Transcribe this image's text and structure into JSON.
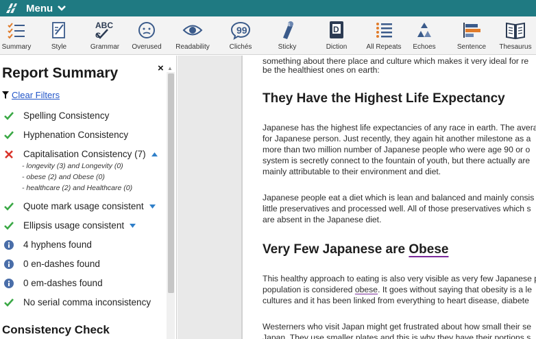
{
  "menubar": {
    "menu_label": "Menu",
    "icon": "feather-logo-icon",
    "bg": "#1f7a82"
  },
  "toolbar": {
    "items": [
      {
        "label": "Summary",
        "icon": "summary-list-icon"
      },
      {
        "label": "Style",
        "icon": "style-pen-icon"
      },
      {
        "label": "Grammar",
        "icon": "grammar-abc-icon"
      },
      {
        "label": "Overused",
        "icon": "overused-face-icon"
      },
      {
        "label": "Readability",
        "icon": "eye-icon"
      },
      {
        "label": "Clichés",
        "icon": "quote-bubble-icon"
      },
      {
        "label": "Sticky",
        "icon": "sticky-glue-icon"
      },
      {
        "label": "Diction",
        "icon": "diction-book-icon"
      },
      {
        "label": "All Repeats",
        "icon": "repeats-list-icon"
      },
      {
        "label": "Echoes",
        "icon": "echoes-recycle-icon"
      },
      {
        "label": "Sentence",
        "icon": "sentence-bars-icon"
      },
      {
        "label": "Thesaurus",
        "icon": "thesaurus-book-icon"
      }
    ]
  },
  "panel": {
    "title": "Report Summary",
    "close": "×",
    "clear_filters": "Clear Filters",
    "rows": [
      {
        "status": "check",
        "label": "Spelling Consistency"
      },
      {
        "status": "check",
        "label": "Hyphenation Consistency"
      },
      {
        "status": "cross",
        "label": "Capitalisation Consistency (7)",
        "expanded": true
      },
      {
        "status": "check",
        "label": "Quote mark usage consistent",
        "collapsed": true
      },
      {
        "status": "check",
        "label": "Ellipsis usage consistent",
        "collapsed": true
      },
      {
        "status": "info",
        "label": "4 hyphens found"
      },
      {
        "status": "info",
        "label": "0 en-dashes found"
      },
      {
        "status": "info",
        "label": "0 em-dashes found"
      },
      {
        "status": "check",
        "label": "No serial comma inconsistency"
      }
    ],
    "sub_items": [
      "- longevity (3) and Longevity (0)",
      "- obese (2) and Obese (0)",
      "- healthcare (2) and Healthcare (0)"
    ],
    "section_title": "Consistency Check",
    "colors": {
      "check": "#3aa845",
      "cross": "#d9342b",
      "info": "#4a6ea9",
      "triangle": "#2f7fc9"
    }
  },
  "doc": {
    "intro": [
      "something about there place and culture which makes it very ideal for re",
      "be the healthiest ones on earth:"
    ],
    "heading1": "They Have the Highest Life Expectancy",
    "para1": [
      "Japanese has the highest life expectancies of any race in earth. The avera",
      "for Japanese person. Just recently, they again hit another milestone as a",
      "more than two million number of Japanese people who were age 90 or o",
      "system is secretly connect to the fountain of youth, but there actually are",
      "mainly attributable to their environment and diet."
    ],
    "para2": [
      "Japanese people eat a diet which is lean and balanced and mainly consis",
      "little preservatives and processed well. All of those preservatives which s",
      "are absent in the Japanese diet."
    ],
    "heading2_prefix": "Very Few Japanese are ",
    "heading2_word": "Obese",
    "para3_line1": "This healthy approach to eating is also very visible as very few Japanese p",
    "para3_line2_pre": "population is considered ",
    "para3_line2_word": "obese",
    "para3_line2_post": ". It goes without saying that obesity is a le",
    "para3_line3": "cultures and it has been linked from everything to heart disease, diabete",
    "para4": [
      "Westerners who visit Japan might get frustrated about how small their se",
      "Japan. They use smaller plates and this is why they have their portions s"
    ]
  }
}
